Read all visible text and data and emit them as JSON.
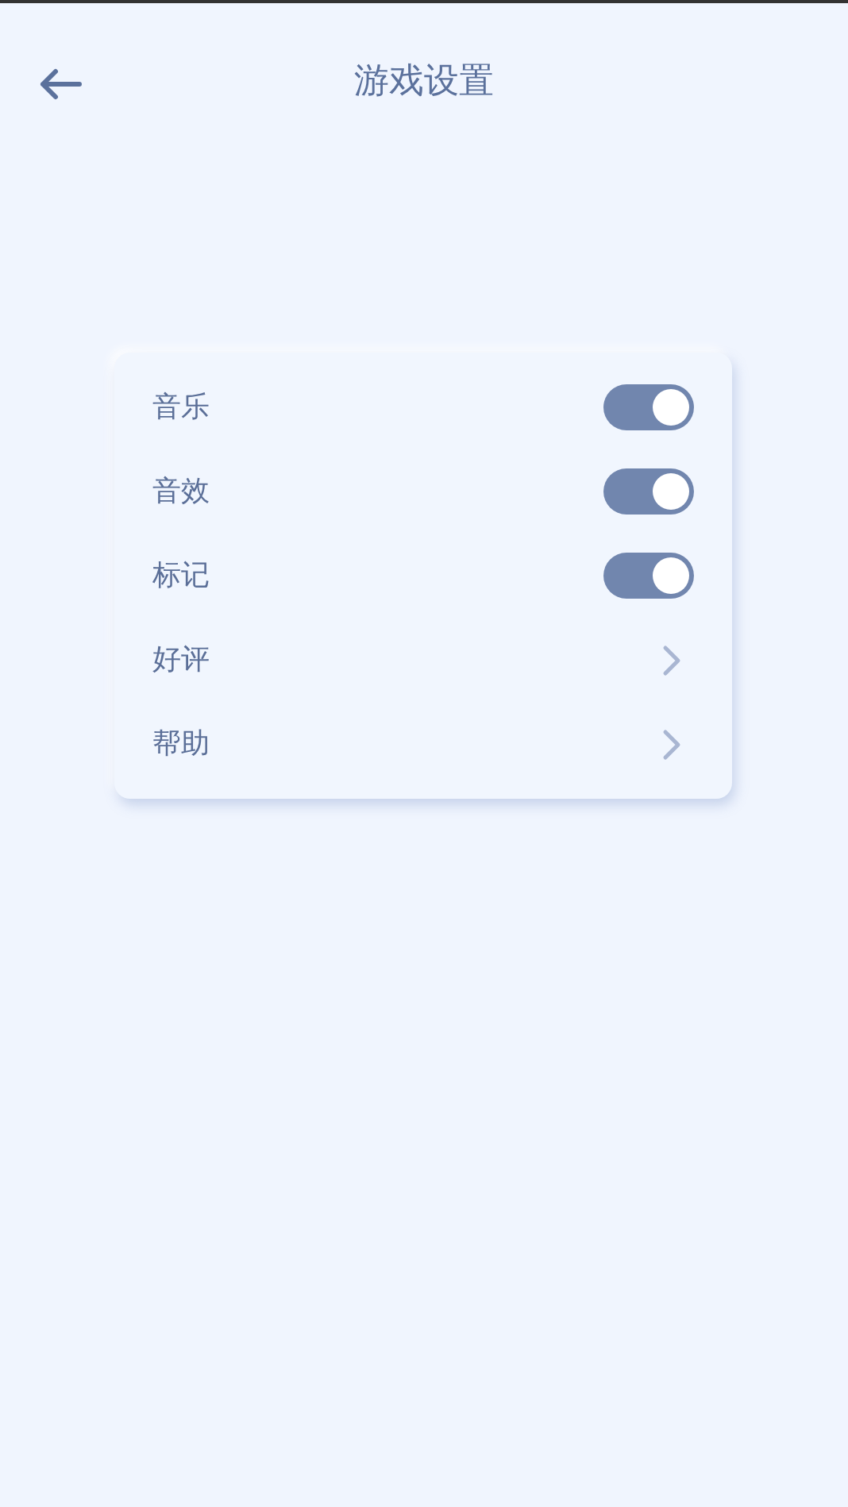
{
  "header": {
    "title": "游戏设置"
  },
  "settings": [
    {
      "kind": "toggle",
      "label": "音乐",
      "on": true
    },
    {
      "kind": "toggle",
      "label": "音效",
      "on": true
    },
    {
      "kind": "toggle",
      "label": "标记",
      "on": true
    },
    {
      "kind": "link",
      "label": "好评"
    },
    {
      "kind": "link",
      "label": "帮助"
    }
  ]
}
